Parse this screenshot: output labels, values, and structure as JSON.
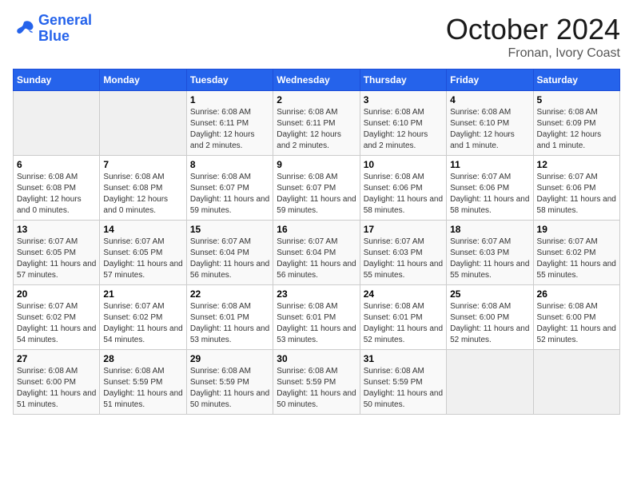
{
  "header": {
    "logo_line1": "General",
    "logo_line2": "Blue",
    "month": "October 2024",
    "location": "Fronan, Ivory Coast"
  },
  "days_of_week": [
    "Sunday",
    "Monday",
    "Tuesday",
    "Wednesday",
    "Thursday",
    "Friday",
    "Saturday"
  ],
  "weeks": [
    [
      {
        "num": "",
        "info": ""
      },
      {
        "num": "",
        "info": ""
      },
      {
        "num": "1",
        "info": "Sunrise: 6:08 AM\nSunset: 6:11 PM\nDaylight: 12 hours and 2 minutes."
      },
      {
        "num": "2",
        "info": "Sunrise: 6:08 AM\nSunset: 6:11 PM\nDaylight: 12 hours and 2 minutes."
      },
      {
        "num": "3",
        "info": "Sunrise: 6:08 AM\nSunset: 6:10 PM\nDaylight: 12 hours and 2 minutes."
      },
      {
        "num": "4",
        "info": "Sunrise: 6:08 AM\nSunset: 6:10 PM\nDaylight: 12 hours and 1 minute."
      },
      {
        "num": "5",
        "info": "Sunrise: 6:08 AM\nSunset: 6:09 PM\nDaylight: 12 hours and 1 minute."
      }
    ],
    [
      {
        "num": "6",
        "info": "Sunrise: 6:08 AM\nSunset: 6:08 PM\nDaylight: 12 hours and 0 minutes."
      },
      {
        "num": "7",
        "info": "Sunrise: 6:08 AM\nSunset: 6:08 PM\nDaylight: 12 hours and 0 minutes."
      },
      {
        "num": "8",
        "info": "Sunrise: 6:08 AM\nSunset: 6:07 PM\nDaylight: 11 hours and 59 minutes."
      },
      {
        "num": "9",
        "info": "Sunrise: 6:08 AM\nSunset: 6:07 PM\nDaylight: 11 hours and 59 minutes."
      },
      {
        "num": "10",
        "info": "Sunrise: 6:08 AM\nSunset: 6:06 PM\nDaylight: 11 hours and 58 minutes."
      },
      {
        "num": "11",
        "info": "Sunrise: 6:07 AM\nSunset: 6:06 PM\nDaylight: 11 hours and 58 minutes."
      },
      {
        "num": "12",
        "info": "Sunrise: 6:07 AM\nSunset: 6:06 PM\nDaylight: 11 hours and 58 minutes."
      }
    ],
    [
      {
        "num": "13",
        "info": "Sunrise: 6:07 AM\nSunset: 6:05 PM\nDaylight: 11 hours and 57 minutes."
      },
      {
        "num": "14",
        "info": "Sunrise: 6:07 AM\nSunset: 6:05 PM\nDaylight: 11 hours and 57 minutes."
      },
      {
        "num": "15",
        "info": "Sunrise: 6:07 AM\nSunset: 6:04 PM\nDaylight: 11 hours and 56 minutes."
      },
      {
        "num": "16",
        "info": "Sunrise: 6:07 AM\nSunset: 6:04 PM\nDaylight: 11 hours and 56 minutes."
      },
      {
        "num": "17",
        "info": "Sunrise: 6:07 AM\nSunset: 6:03 PM\nDaylight: 11 hours and 55 minutes."
      },
      {
        "num": "18",
        "info": "Sunrise: 6:07 AM\nSunset: 6:03 PM\nDaylight: 11 hours and 55 minutes."
      },
      {
        "num": "19",
        "info": "Sunrise: 6:07 AM\nSunset: 6:02 PM\nDaylight: 11 hours and 55 minutes."
      }
    ],
    [
      {
        "num": "20",
        "info": "Sunrise: 6:07 AM\nSunset: 6:02 PM\nDaylight: 11 hours and 54 minutes."
      },
      {
        "num": "21",
        "info": "Sunrise: 6:07 AM\nSunset: 6:02 PM\nDaylight: 11 hours and 54 minutes."
      },
      {
        "num": "22",
        "info": "Sunrise: 6:08 AM\nSunset: 6:01 PM\nDaylight: 11 hours and 53 minutes."
      },
      {
        "num": "23",
        "info": "Sunrise: 6:08 AM\nSunset: 6:01 PM\nDaylight: 11 hours and 53 minutes."
      },
      {
        "num": "24",
        "info": "Sunrise: 6:08 AM\nSunset: 6:01 PM\nDaylight: 11 hours and 52 minutes."
      },
      {
        "num": "25",
        "info": "Sunrise: 6:08 AM\nSunset: 6:00 PM\nDaylight: 11 hours and 52 minutes."
      },
      {
        "num": "26",
        "info": "Sunrise: 6:08 AM\nSunset: 6:00 PM\nDaylight: 11 hours and 52 minutes."
      }
    ],
    [
      {
        "num": "27",
        "info": "Sunrise: 6:08 AM\nSunset: 6:00 PM\nDaylight: 11 hours and 51 minutes."
      },
      {
        "num": "28",
        "info": "Sunrise: 6:08 AM\nSunset: 5:59 PM\nDaylight: 11 hours and 51 minutes."
      },
      {
        "num": "29",
        "info": "Sunrise: 6:08 AM\nSunset: 5:59 PM\nDaylight: 11 hours and 50 minutes."
      },
      {
        "num": "30",
        "info": "Sunrise: 6:08 AM\nSunset: 5:59 PM\nDaylight: 11 hours and 50 minutes."
      },
      {
        "num": "31",
        "info": "Sunrise: 6:08 AM\nSunset: 5:59 PM\nDaylight: 11 hours and 50 minutes."
      },
      {
        "num": "",
        "info": ""
      },
      {
        "num": "",
        "info": ""
      }
    ]
  ]
}
